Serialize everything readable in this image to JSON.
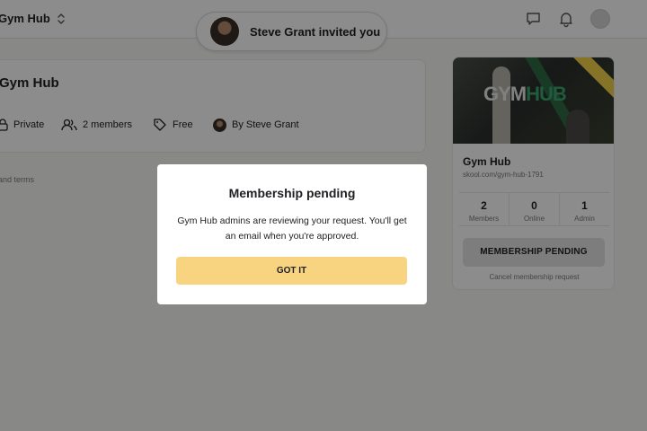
{
  "header": {
    "group_name": "Gym Hub",
    "icons": [
      "unfold-icon",
      "chat-icon",
      "bell-icon",
      "avatar"
    ]
  },
  "invite": {
    "text": "Steve Grant invited you"
  },
  "main": {
    "title": "Gym Hub",
    "meta": {
      "privacy": "Private",
      "members": "2 members",
      "price": "Free",
      "owner": "By Steve Grant"
    },
    "terms_link": "and terms"
  },
  "sidebar": {
    "cover_logo": {
      "part1": "GYM",
      "part2": "HUB"
    },
    "name": "Gym Hub",
    "url": "skool.com/gym-hub-1791",
    "stats": [
      {
        "value": "2",
        "label": "Members"
      },
      {
        "value": "0",
        "label": "Online"
      },
      {
        "value": "1",
        "label": "Admin"
      }
    ],
    "pending_button": "MEMBERSHIP PENDING",
    "cancel_link": "Cancel membership request"
  },
  "modal": {
    "title": "Membership pending",
    "body": "Gym Hub admins are reviewing your request. You'll get an email when you're approved.",
    "button": "GOT IT"
  },
  "colors": {
    "accent_button": "#f8d481",
    "overlay": "rgba(0,0,0,0.45)",
    "background": "#f8f7f5"
  }
}
